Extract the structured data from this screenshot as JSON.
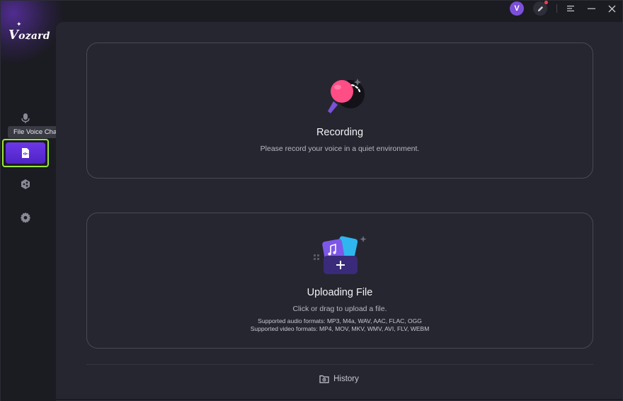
{
  "app": {
    "logo_text": "Vozard",
    "logo_initial": "V",
    "logo_rest": "ozard"
  },
  "titlebar": {
    "avatar_letter": "V",
    "icons": [
      "user-avatar",
      "feedback-pen-icon",
      "menu-icon",
      "minimize-icon",
      "close-icon"
    ]
  },
  "sidebar": {
    "tooltip": "File Voice Changer",
    "items": [
      {
        "name": "microphone-icon",
        "active": false
      },
      {
        "name": "file-voice-changer",
        "active": true
      },
      {
        "name": "share-icon",
        "active": false
      },
      {
        "name": "settings-icon",
        "active": false
      }
    ]
  },
  "recording": {
    "title": "Recording",
    "subtitle": "Please record your voice in a quiet environment."
  },
  "upload": {
    "title": "Uploading File",
    "subtitle": "Click or drag to upload a file.",
    "audio_formats": "Supported audio formats: MP3, M4a, WAV, AAC, FLAC, OGG",
    "video_formats": "Supported video formats: MP4, MOV, MKV, WMV, AVI, FLV, WEBM"
  },
  "history": {
    "label": "History"
  },
  "colors": {
    "accent": "#6d37e8",
    "highlight": "#9ae63a",
    "background": "#1b1b22",
    "panel": "#262630",
    "mic_pink": "#ff4d86"
  }
}
